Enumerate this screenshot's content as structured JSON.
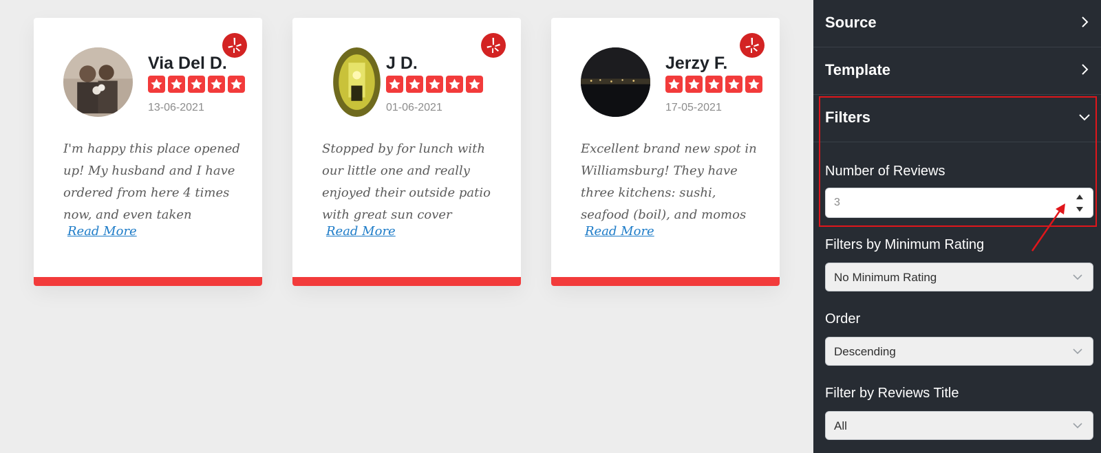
{
  "reviews": [
    {
      "name": "Via Del D.",
      "date": "13-06-2021",
      "rating": 5,
      "text": "I'm happy this place opened up! My husband and I have ordered from here 4 times now, and even taken",
      "read_more": "Read More",
      "source_icon": "yelp-icon"
    },
    {
      "name": "J D.",
      "date": "01-06-2021",
      "rating": 5,
      "text": "Stopped by for lunch with our little one and really enjoyed their outside patio with great sun cover",
      "read_more": "Read More",
      "source_icon": "yelp-icon"
    },
    {
      "name": "Jerzy F.",
      "date": "17-05-2021",
      "rating": 5,
      "text": "Excellent brand new spot in Williamsburg! They have three kitchens: sushi, seafood (boil), and momos",
      "read_more": "Read More",
      "source_icon": "yelp-icon"
    }
  ],
  "panel": {
    "sections": {
      "source": "Source",
      "template": "Template",
      "filters": "Filters"
    },
    "filters": {
      "number_of_reviews_label": "Number of Reviews",
      "number_of_reviews_value": "3",
      "min_rating_label": "Filters by Minimum Rating",
      "min_rating_value": "No Minimum Rating",
      "order_label": "Order",
      "order_value": "Descending",
      "title_filter_label": "Filter by Reviews Title",
      "title_filter_value": "All"
    }
  },
  "colors": {
    "accent_red": "#f23b3b",
    "yelp_red": "#d32323",
    "panel_bg": "#272c33",
    "link_blue": "#1e7cc8",
    "highlight_red": "#e0161b"
  }
}
